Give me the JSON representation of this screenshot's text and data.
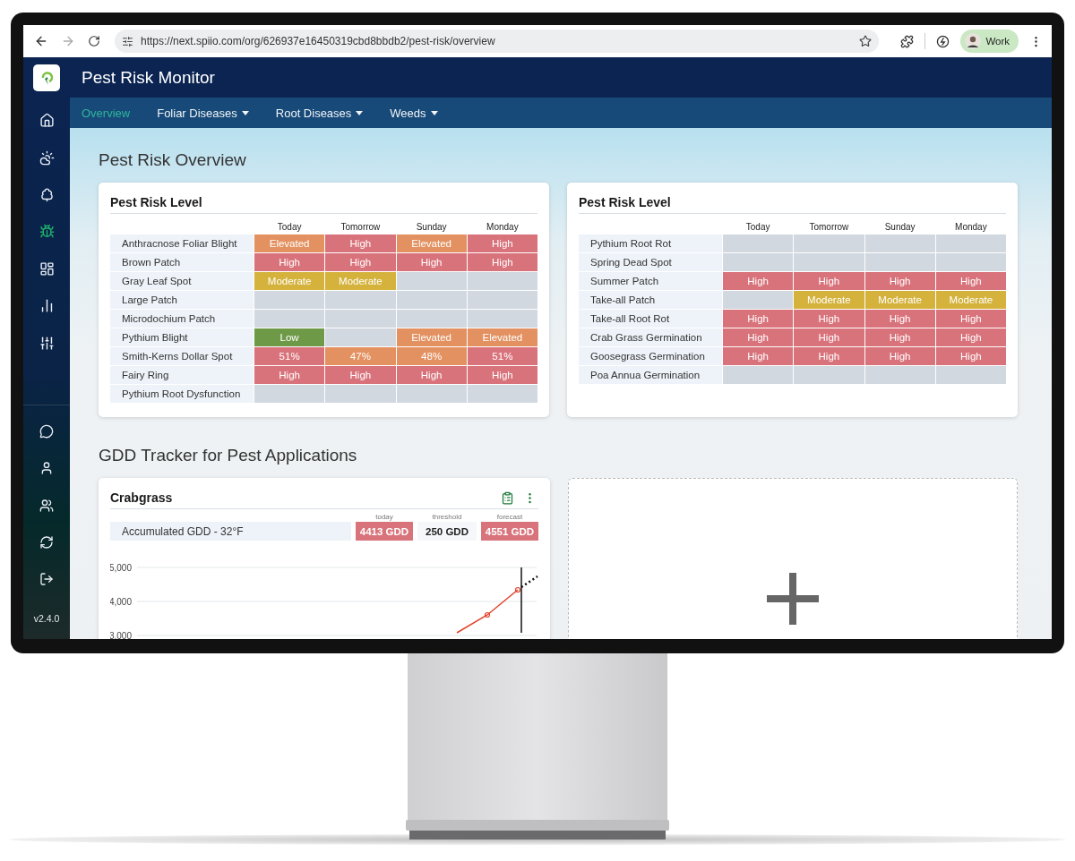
{
  "browser": {
    "url": "https://next.spiio.com/org/626937e16450319cbd8bbdb2/pest-risk/overview",
    "profile": "Work"
  },
  "app": {
    "title": "Pest Risk Monitor"
  },
  "nav_tabs": [
    {
      "label": "Overview",
      "selected": true,
      "dropdown": false
    },
    {
      "label": "Foliar Diseases",
      "selected": false,
      "dropdown": true
    },
    {
      "label": "Root Diseases",
      "selected": false,
      "dropdown": true
    },
    {
      "label": "Weeds",
      "selected": false,
      "dropdown": true
    }
  ],
  "sidebar": {
    "top_items": [
      {
        "selected": false
      },
      {
        "selected": false
      },
      {
        "selected": false
      },
      {
        "selected": true
      },
      {
        "selected": false
      },
      {
        "selected": false
      },
      {
        "selected": false
      }
    ],
    "bottom_items": [
      {
        "selected": false
      },
      {
        "selected": false
      },
      {
        "selected": false
      },
      {
        "selected": false
      },
      {
        "selected": false
      }
    ],
    "version": "v2.4.0"
  },
  "overview_heading": "Pest Risk Overview",
  "risk_panels": [
    {
      "title": "Pest Risk Level",
      "columns": [
        "Today",
        "Tomorrow",
        "Sunday",
        "Monday"
      ],
      "rows": [
        {
          "name": "Anthracnose Foliar Blight",
          "cells": [
            {
              "text": "Elevated",
              "color": "#e39160"
            },
            {
              "text": "High",
              "color": "#d9737b"
            },
            {
              "text": "Elevated",
              "color": "#e39160"
            },
            {
              "text": "High",
              "color": "#d9737b"
            }
          ]
        },
        {
          "name": "Brown Patch",
          "cells": [
            {
              "text": "High",
              "color": "#d9737b"
            },
            {
              "text": "High",
              "color": "#d9737b"
            },
            {
              "text": "High",
              "color": "#d9737b"
            },
            {
              "text": "High",
              "color": "#d9737b"
            }
          ]
        },
        {
          "name": "Gray Leaf Spot",
          "cells": [
            {
              "text": "Moderate",
              "color": "#d4b23c"
            },
            {
              "text": "Moderate",
              "color": "#d4b23c"
            },
            {
              "color": "#d1d8e0"
            },
            {
              "color": "#d1d8e0"
            }
          ]
        },
        {
          "name": "Large Patch",
          "cells": [
            {
              "color": "#d1d8e0"
            },
            {
              "color": "#d1d8e0"
            },
            {
              "color": "#d1d8e0"
            },
            {
              "color": "#d1d8e0"
            }
          ]
        },
        {
          "name": "Microdochium Patch",
          "cells": [
            {
              "color": "#d1d8e0"
            },
            {
              "color": "#d1d8e0"
            },
            {
              "color": "#d1d8e0"
            },
            {
              "color": "#d1d8e0"
            }
          ]
        },
        {
          "name": "Pythium Blight",
          "cells": [
            {
              "text": "Low",
              "color": "#6e9a47"
            },
            {
              "color": "#d1d8e0"
            },
            {
              "text": "Elevated",
              "color": "#e39160"
            },
            {
              "text": "Elevated",
              "color": "#e39160"
            }
          ]
        },
        {
          "name": "Smith-Kerns Dollar Spot",
          "cells": [
            {
              "text": "51%",
              "color": "#d9737b"
            },
            {
              "text": "47%",
              "color": "#e39160"
            },
            {
              "text": "48%",
              "color": "#e39160"
            },
            {
              "text": "51%",
              "color": "#d9737b"
            }
          ]
        },
        {
          "name": "Fairy Ring",
          "cells": [
            {
              "text": "High",
              "color": "#d9737b"
            },
            {
              "text": "High",
              "color": "#d9737b"
            },
            {
              "text": "High",
              "color": "#d9737b"
            },
            {
              "text": "High",
              "color": "#d9737b"
            }
          ]
        },
        {
          "name": "Pythium Root Dysfunction",
          "cells": [
            {
              "color": "#d1d8e0"
            },
            {
              "color": "#d1d8e0"
            },
            {
              "color": "#d1d8e0"
            },
            {
              "color": "#d1d8e0"
            }
          ]
        }
      ]
    },
    {
      "title": "Pest Risk Level",
      "columns": [
        "Today",
        "Tomorrow",
        "Sunday",
        "Monday"
      ],
      "rows": [
        {
          "name": "Pythium Root Rot",
          "cells": [
            {
              "color": "#d1d8e0"
            },
            {
              "color": "#d1d8e0"
            },
            {
              "color": "#d1d8e0"
            },
            {
              "color": "#d1d8e0"
            }
          ]
        },
        {
          "name": "Spring Dead Spot",
          "cells": [
            {
              "color": "#d1d8e0"
            },
            {
              "color": "#d1d8e0"
            },
            {
              "color": "#d1d8e0"
            },
            {
              "color": "#d1d8e0"
            }
          ]
        },
        {
          "name": "Summer Patch",
          "cells": [
            {
              "text": "High",
              "color": "#d9737b"
            },
            {
              "text": "High",
              "color": "#d9737b"
            },
            {
              "text": "High",
              "color": "#d9737b"
            },
            {
              "text": "High",
              "color": "#d9737b"
            }
          ]
        },
        {
          "name": "Take-all Patch",
          "cells": [
            {
              "color": "#d1d8e0"
            },
            {
              "text": "Moderate",
              "color": "#d4b23c"
            },
            {
              "text": "Moderate",
              "color": "#d4b23c"
            },
            {
              "text": "Moderate",
              "color": "#d4b23c"
            }
          ]
        },
        {
          "name": "Take-all Root Rot",
          "cells": [
            {
              "text": "High",
              "color": "#d9737b"
            },
            {
              "text": "High",
              "color": "#d9737b"
            },
            {
              "text": "High",
              "color": "#d9737b"
            },
            {
              "text": "High",
              "color": "#d9737b"
            }
          ]
        },
        {
          "name": "Crab Grass Germination",
          "cells": [
            {
              "text": "High",
              "color": "#d9737b"
            },
            {
              "text": "High",
              "color": "#d9737b"
            },
            {
              "text": "High",
              "color": "#d9737b"
            },
            {
              "text": "High",
              "color": "#d9737b"
            }
          ]
        },
        {
          "name": "Goosegrass Germination",
          "cells": [
            {
              "text": "High",
              "color": "#d9737b"
            },
            {
              "text": "High",
              "color": "#d9737b"
            },
            {
              "text": "High",
              "color": "#d9737b"
            },
            {
              "text": "High",
              "color": "#d9737b"
            }
          ]
        },
        {
          "name": "Poa Annua Germination",
          "cells": [
            {
              "color": "#d1d8e0"
            },
            {
              "color": "#d1d8e0"
            },
            {
              "color": "#d1d8e0"
            },
            {
              "color": "#d1d8e0"
            }
          ]
        }
      ]
    }
  ],
  "gdd_heading": "GDD Tracker for Pest Applications",
  "gdd_card": {
    "title": "Crabgrass",
    "row_label": "Accumulated GDD - 32°F",
    "stats": [
      {
        "label": "today",
        "value": "4413 GDD",
        "color": "#d9737b"
      },
      {
        "label": "threshold",
        "value": "250 GDD",
        "color": "#f5f7fa"
      },
      {
        "label": "forecast",
        "value": "4551 GDD",
        "color": "#d9737b"
      }
    ],
    "chart": {
      "y_labels": [
        "5,000",
        "4,000",
        "3,000"
      ]
    }
  },
  "add_card": {
    "kind": "empty"
  }
}
